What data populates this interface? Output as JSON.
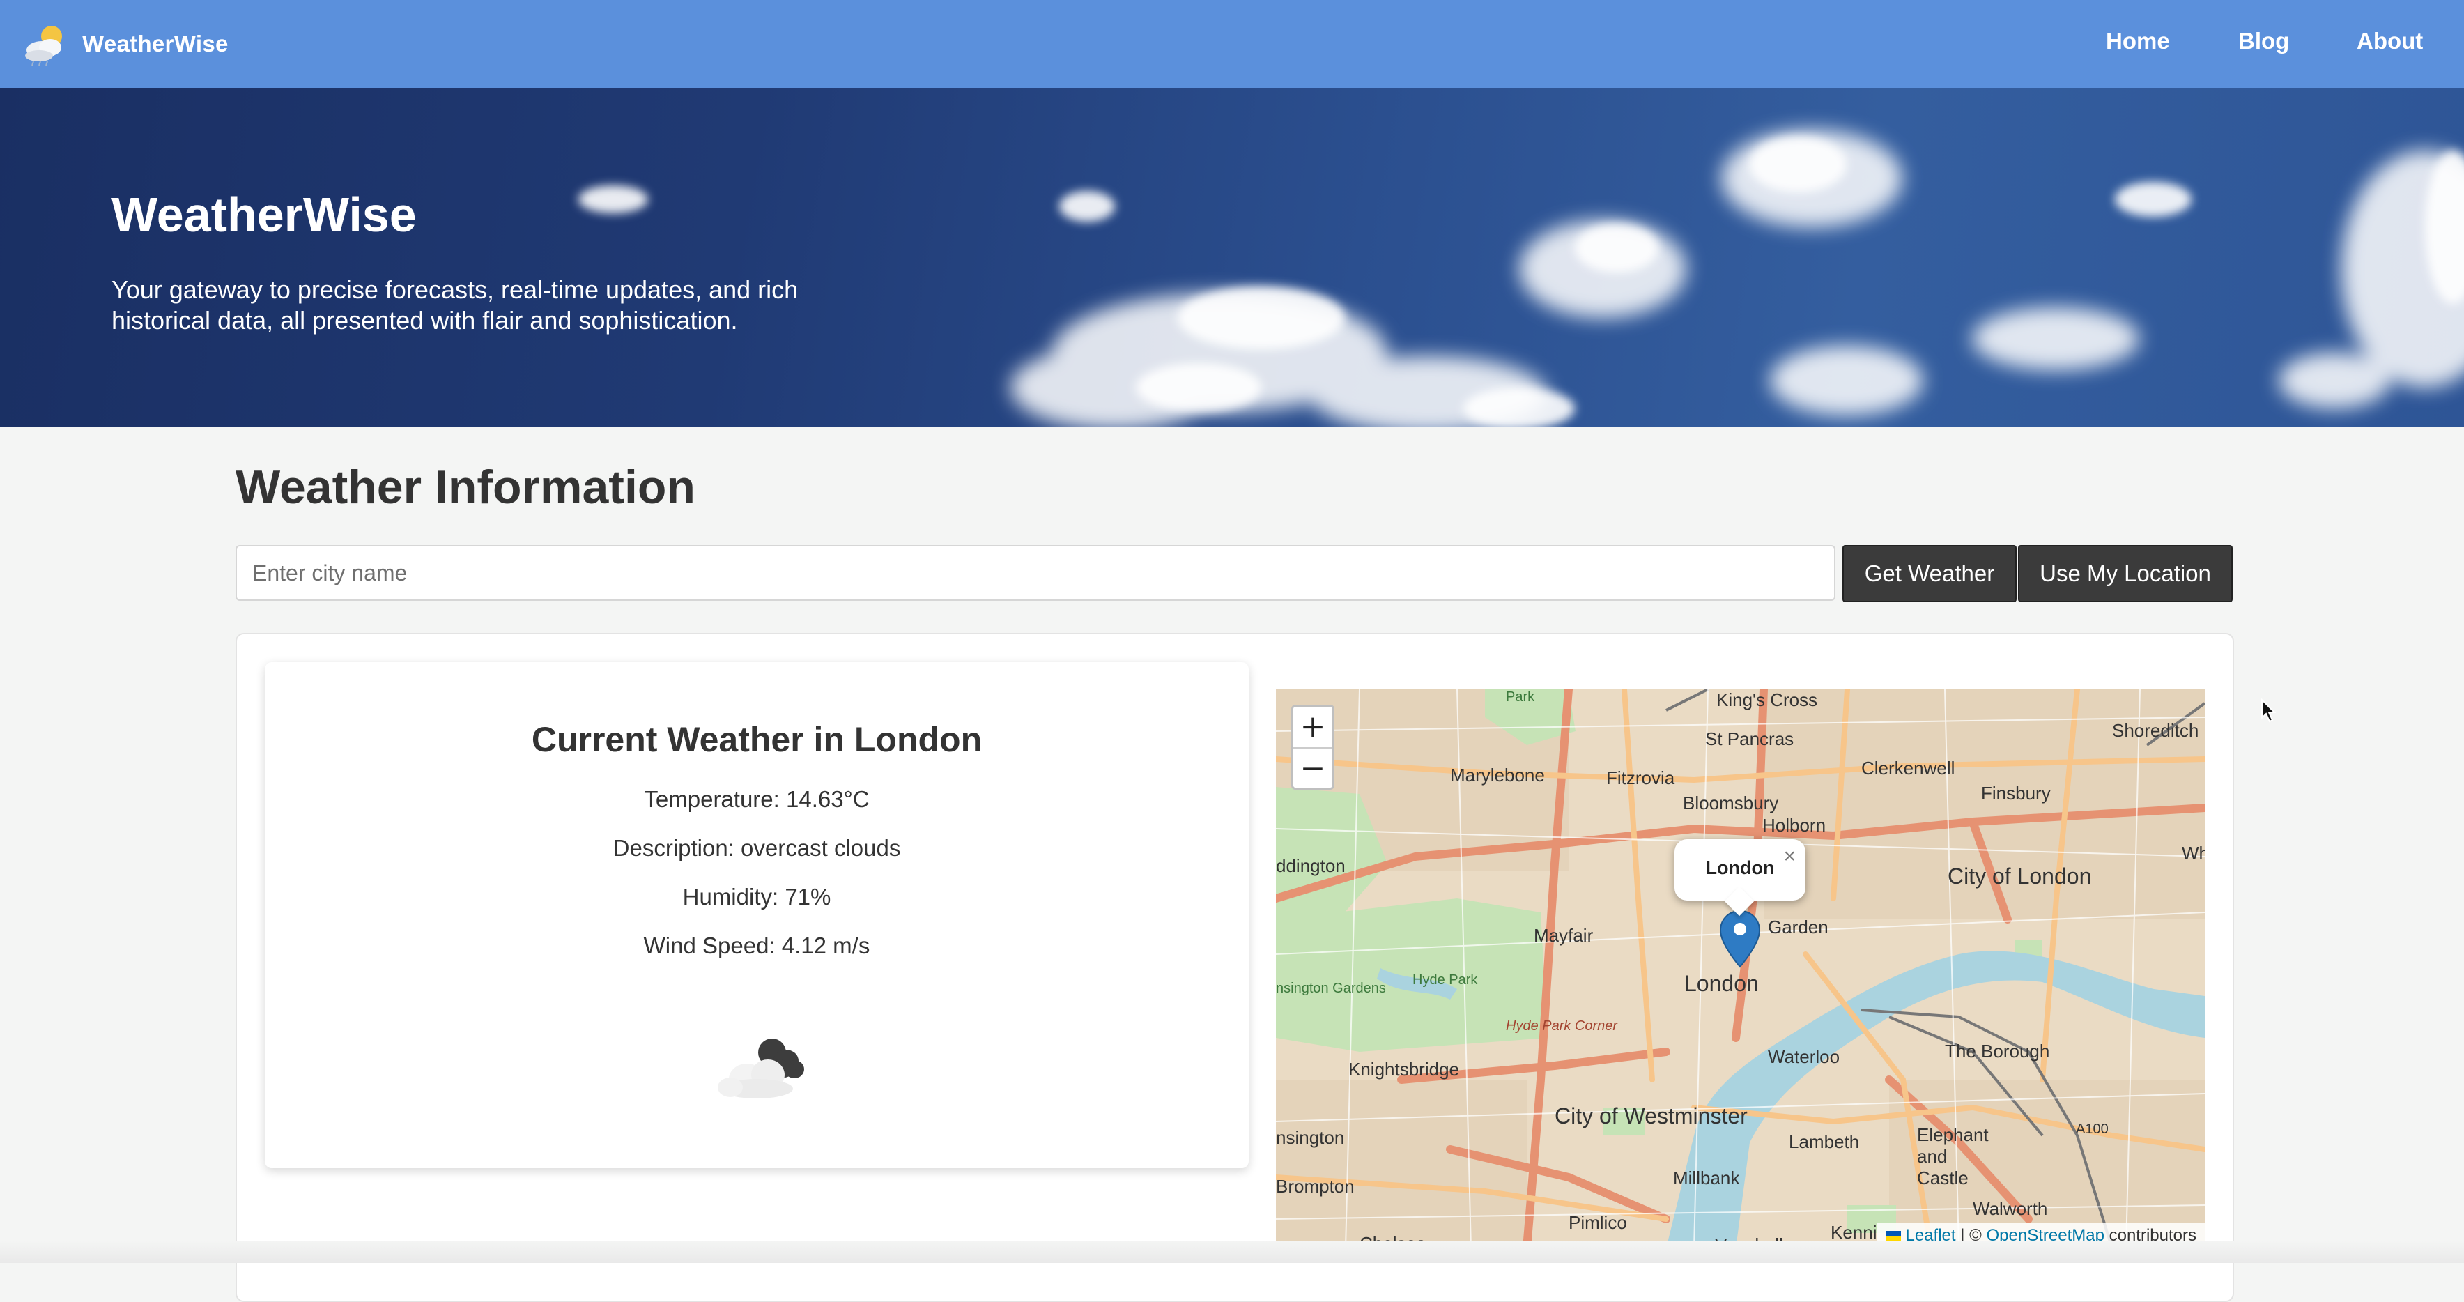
{
  "app": {
    "brand_name": "WeatherWise",
    "nav": [
      "Home",
      "Blog",
      "About"
    ]
  },
  "hero": {
    "title": "WeatherWise",
    "subtitle": "Your gateway to precise forecasts, real-time updates, and rich historical data, all presented with flair and sophistication."
  },
  "main": {
    "section_title": "Weather Information",
    "search": {
      "placeholder": "Enter city name",
      "value": ""
    },
    "buttons": {
      "get_weather": "Get Weather",
      "use_location": "Use My Location"
    }
  },
  "weather": {
    "title": "Current Weather in London",
    "temperature": "Temperature: 14.63°C",
    "description": "Description: overcast clouds",
    "humidity": "Humidity: 71%",
    "wind": "Wind Speed: 4.12 m/s",
    "icon": "overcast-clouds-icon"
  },
  "map": {
    "zoom_in": "+",
    "zoom_out": "−",
    "popup_label": "London",
    "popup_close": "×",
    "attribution": {
      "leaflet": "Leaflet",
      "sep": " | © ",
      "osm": "OpenStreetMap",
      "suffix": " contributors"
    },
    "labels": [
      "King's Cross",
      "St Pancras",
      "Shoreditch",
      "Marylebone",
      "Fitzrovia",
      "Clerkenwell",
      "Finsbury",
      "Bloomsbury",
      "Holborn",
      "Park",
      "ddington",
      "City of London",
      "Garden",
      "Mayfair",
      "London",
      "Hyde Park",
      "Hyde Park Corner",
      "nsington Gardens",
      "Knightsbridge",
      "Waterloo",
      "The Borough",
      "Whi",
      "City of Westminster",
      "Lambeth",
      "Elephant and Castle",
      "nsington",
      "Millbank",
      "Brompton",
      "A100",
      "Pimlico",
      "Walworth",
      "Kenni",
      "Chelsea",
      "Vauxhall"
    ]
  },
  "colors": {
    "nav_bg": "#5b90dc",
    "button_bg": "#3b3b3b",
    "page_bg": "#f4f5f4",
    "map_marker": "#2e7bc4"
  }
}
